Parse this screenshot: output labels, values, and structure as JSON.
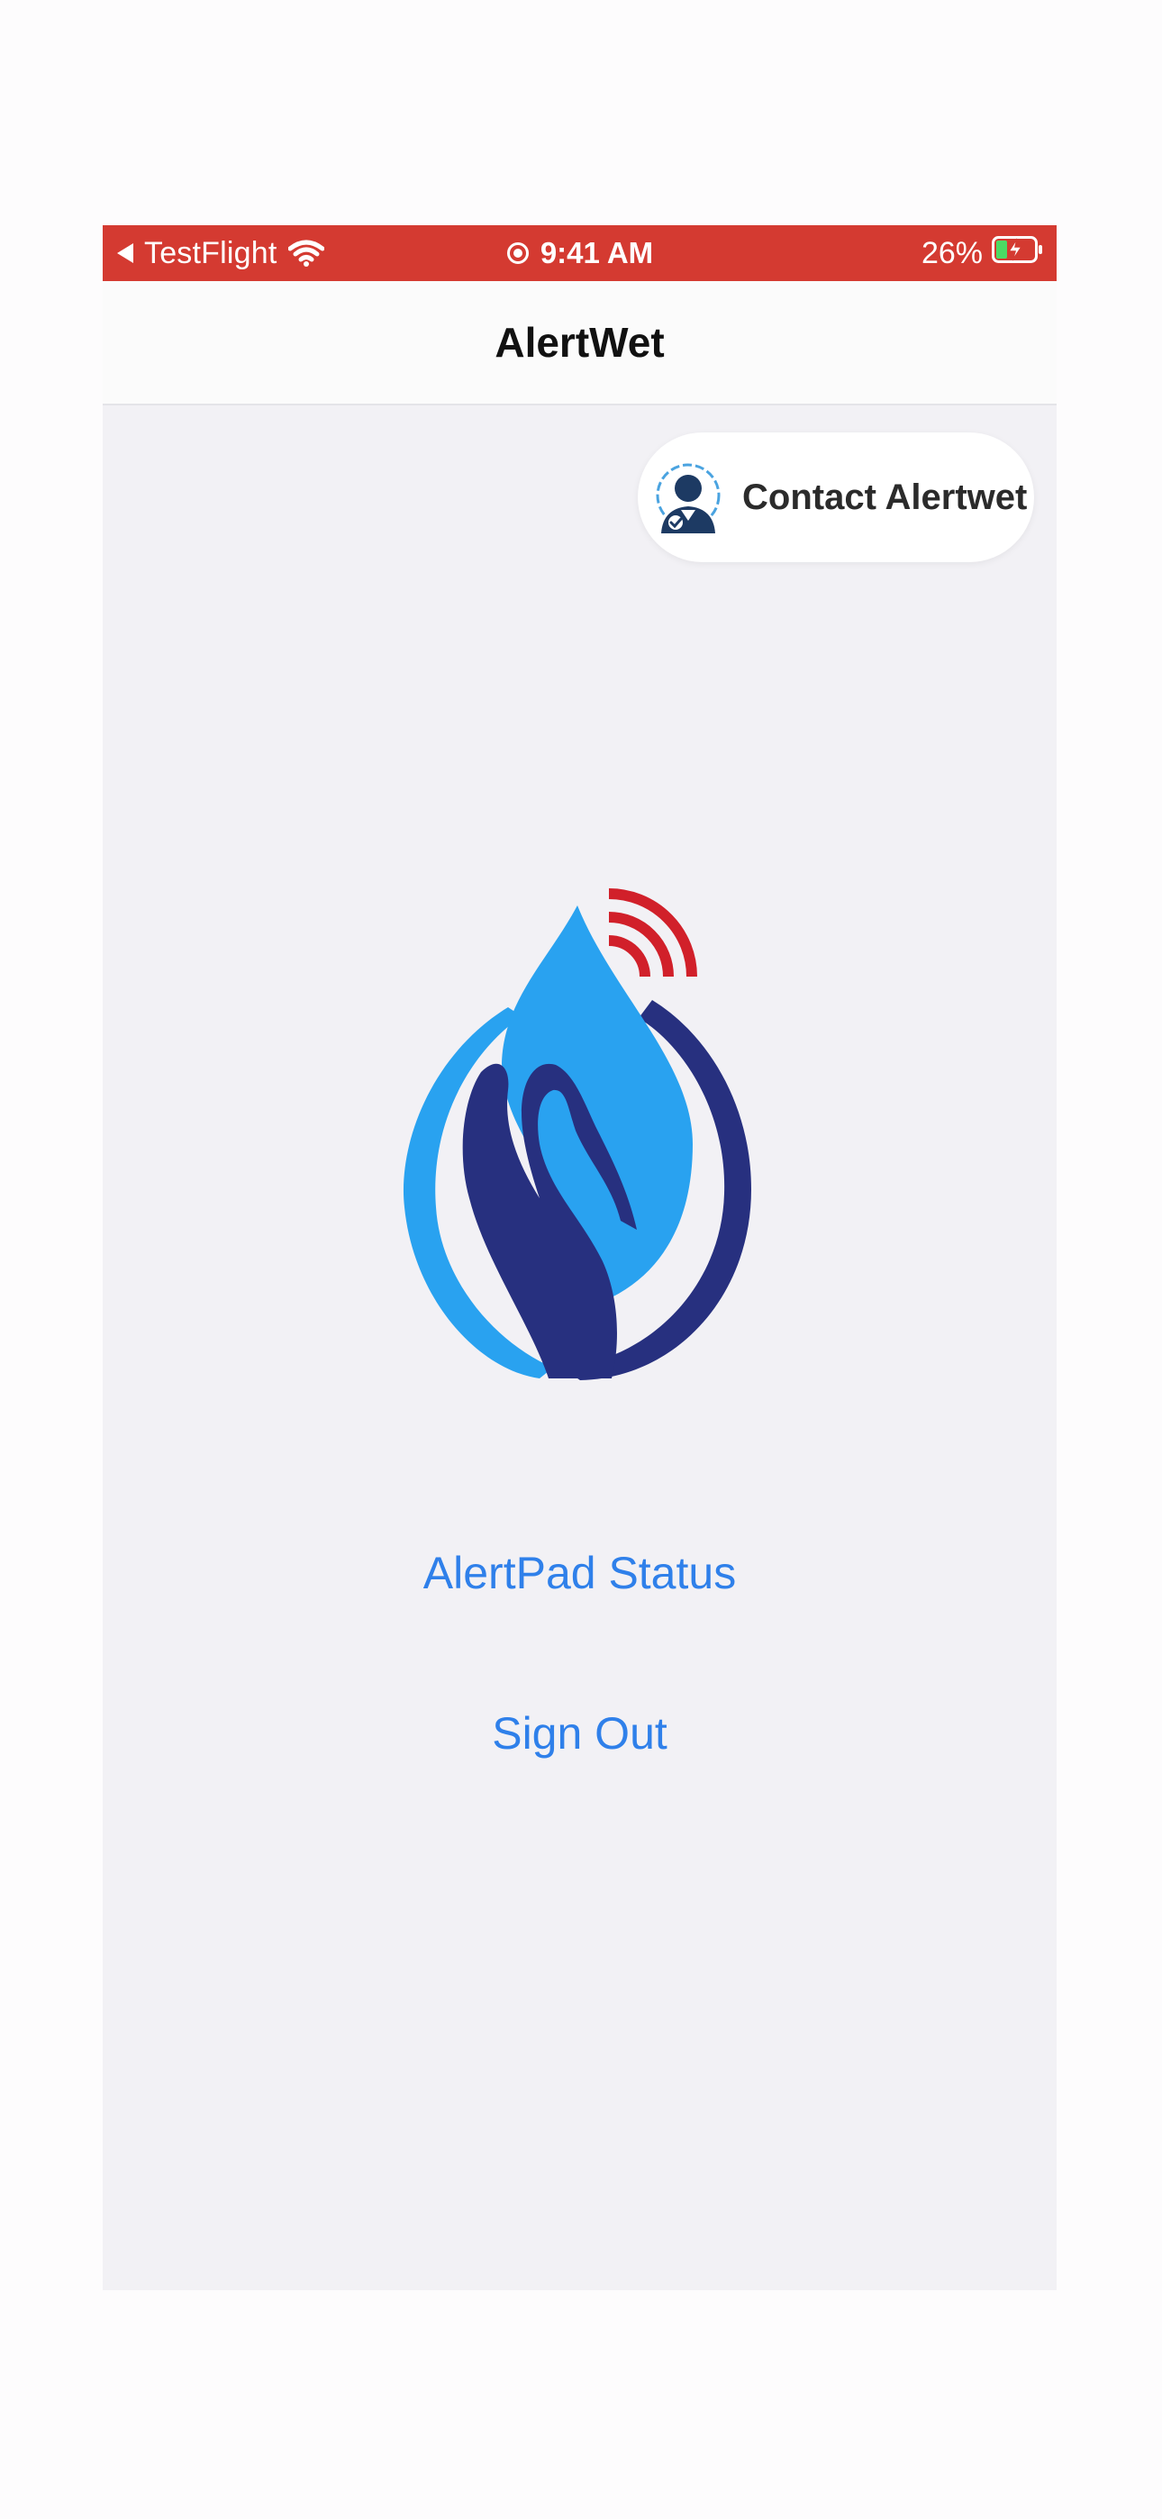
{
  "status_bar": {
    "back_app": "TestFlight",
    "time": "9:41 AM",
    "battery_percent": "26%",
    "battery_level": 0.26,
    "charging": true,
    "icons": [
      "back-arrow-icon",
      "wifi-icon",
      "location-icon",
      "battery-charging-icon"
    ]
  },
  "nav": {
    "title": "AlertWet"
  },
  "contact_button": {
    "label": "Contact Alertwet",
    "icon": "support-agent-icon"
  },
  "logo": {
    "icon": "alertwet-logo-icon"
  },
  "actions": {
    "status_label": "AlertPad Status",
    "signout_label": "Sign Out"
  },
  "colors": {
    "status_bar_bg": "#d43a31",
    "link_blue": "#2f80ea",
    "drop_blue": "#29a2f0",
    "hand_navy": "#27307f",
    "signal_red": "#d1202a",
    "screen_bg": "#f2f1f5"
  }
}
